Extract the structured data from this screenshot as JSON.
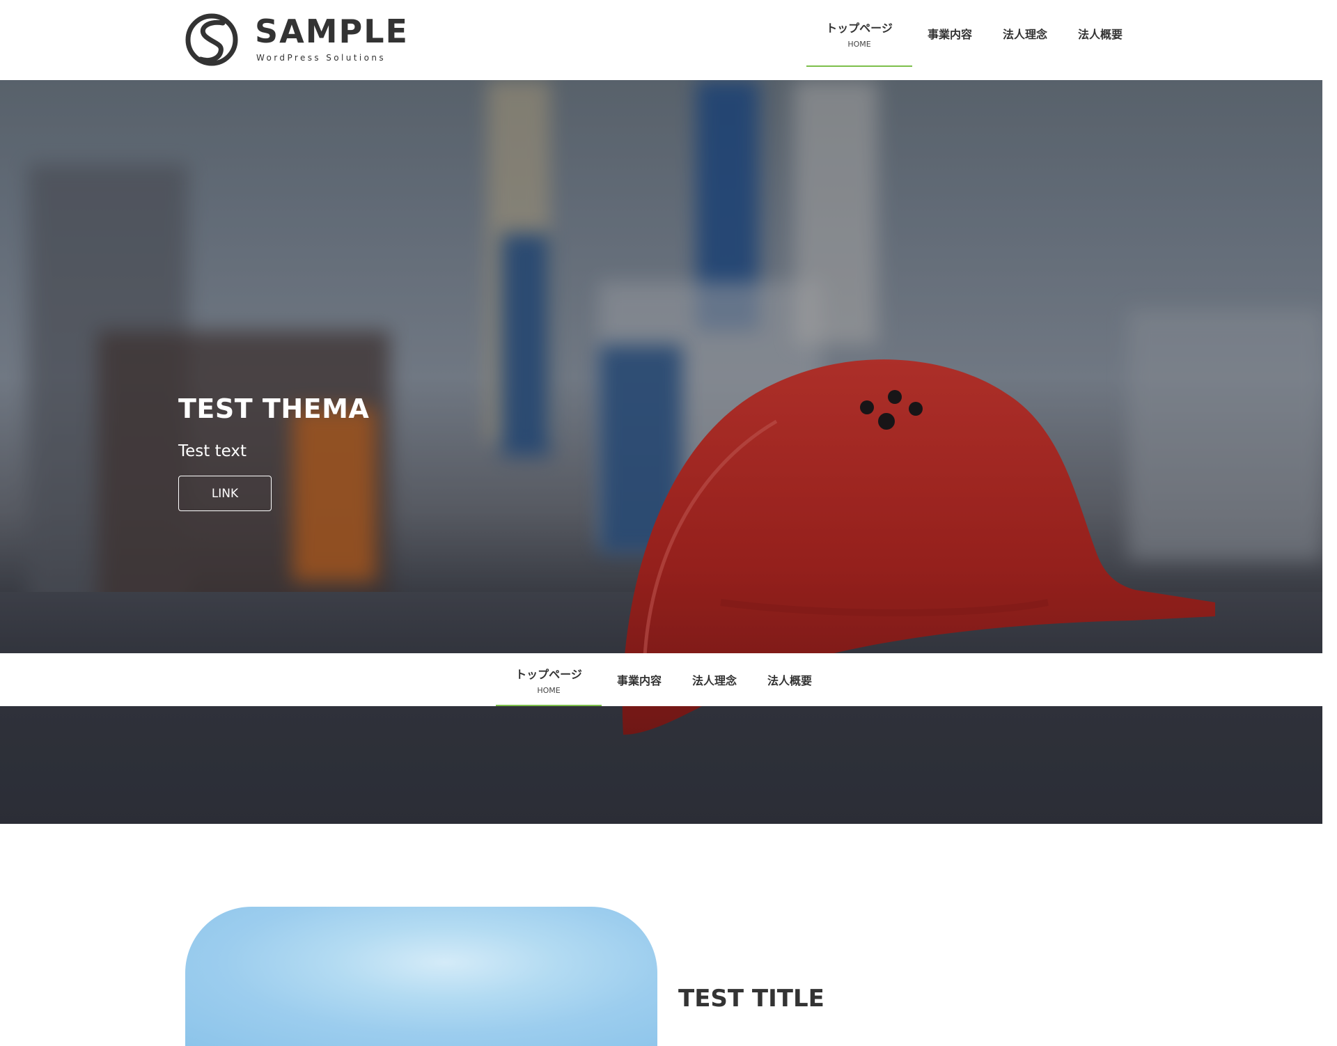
{
  "brand": {
    "name": "SAMPLE",
    "tagline": "WordPress Solutions"
  },
  "nav": {
    "items": [
      {
        "label": "トップページ",
        "sub": "HOME"
      },
      {
        "label": "事業内容"
      },
      {
        "label": "法人理念"
      },
      {
        "label": "法人概要"
      }
    ],
    "active_index": 0
  },
  "hero": {
    "title": "TEST THEMA",
    "text": "Test text",
    "button_label": "LINK"
  },
  "section": {
    "title": "TEST TITLE"
  },
  "colors": {
    "accent": "#7cbf4a",
    "text": "#333333",
    "helmet": "#c4251e",
    "sky": "#9ccdee"
  },
  "icons": {
    "logo_mark": "s-circle-logo-icon"
  }
}
